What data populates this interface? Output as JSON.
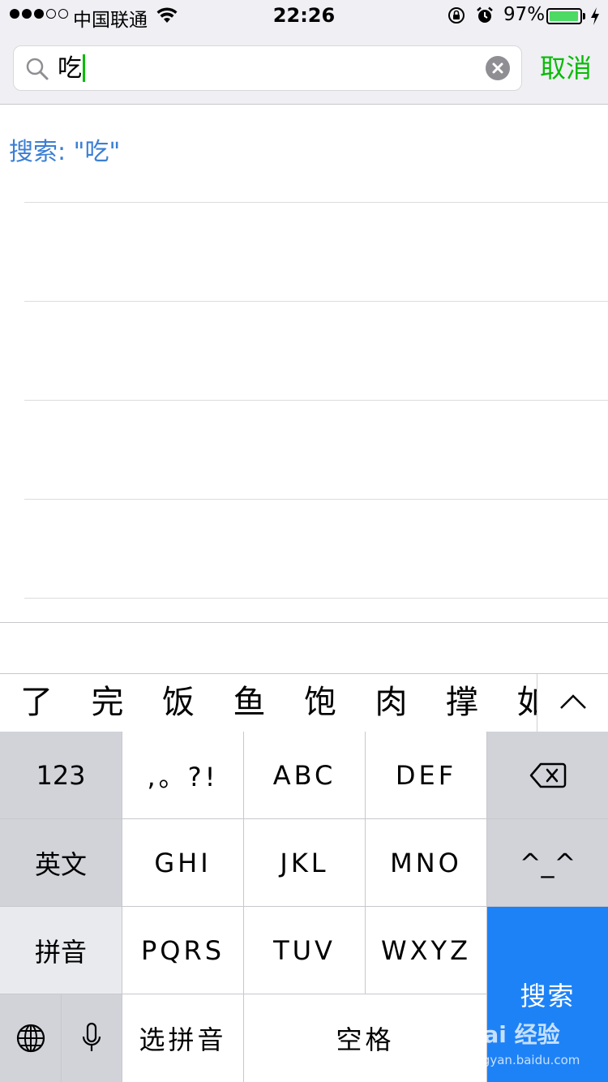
{
  "status_bar": {
    "carrier": "中国联通",
    "time": "22:26",
    "battery_percent_label": "97%",
    "battery_level": 0.97,
    "signal_filled": 3,
    "signal_total": 5
  },
  "search": {
    "query": "吃",
    "cancel_label": "取消"
  },
  "results": {
    "suggestion": "搜索: \"吃\""
  },
  "candidates": {
    "items": [
      "了",
      "完",
      "饭",
      "鱼",
      "饱",
      "肉",
      "撑",
      "如"
    ]
  },
  "keyboard": {
    "row1": {
      "numbers": "123",
      "punct": ",。?!",
      "abc": "ABC",
      "def": "DEF"
    },
    "row2": {
      "english": "英文",
      "ghi": "GHI",
      "jkl": "JKL",
      "mno": "MNO",
      "emoticon": "^_^"
    },
    "row3": {
      "pinyin": "拼音",
      "pqrs": "PQRS",
      "tuv": "TUV",
      "wxyz": "WXYZ"
    },
    "row4": {
      "select_pinyin": "选拼音",
      "space": "空格"
    },
    "search_label": "搜索"
  },
  "watermark": {
    "brand": "Bai 经验",
    "url": "jingyan.baidu.com"
  },
  "colors": {
    "accent_green": "#09bb07",
    "link_blue": "#3b7fd4",
    "search_key_blue": "#1e82f7",
    "battery_green": "#4cd964"
  },
  "icons": {
    "wifi": "wifi-icon",
    "orientation_lock": "orientation-lock-icon",
    "alarm": "alarm-icon",
    "charging": "bolt-icon",
    "search": "search-icon",
    "clear": "clear-icon",
    "expand": "chevron-up-icon",
    "backspace": "backspace-icon",
    "globe": "globe-icon",
    "microphone": "microphone-icon"
  }
}
